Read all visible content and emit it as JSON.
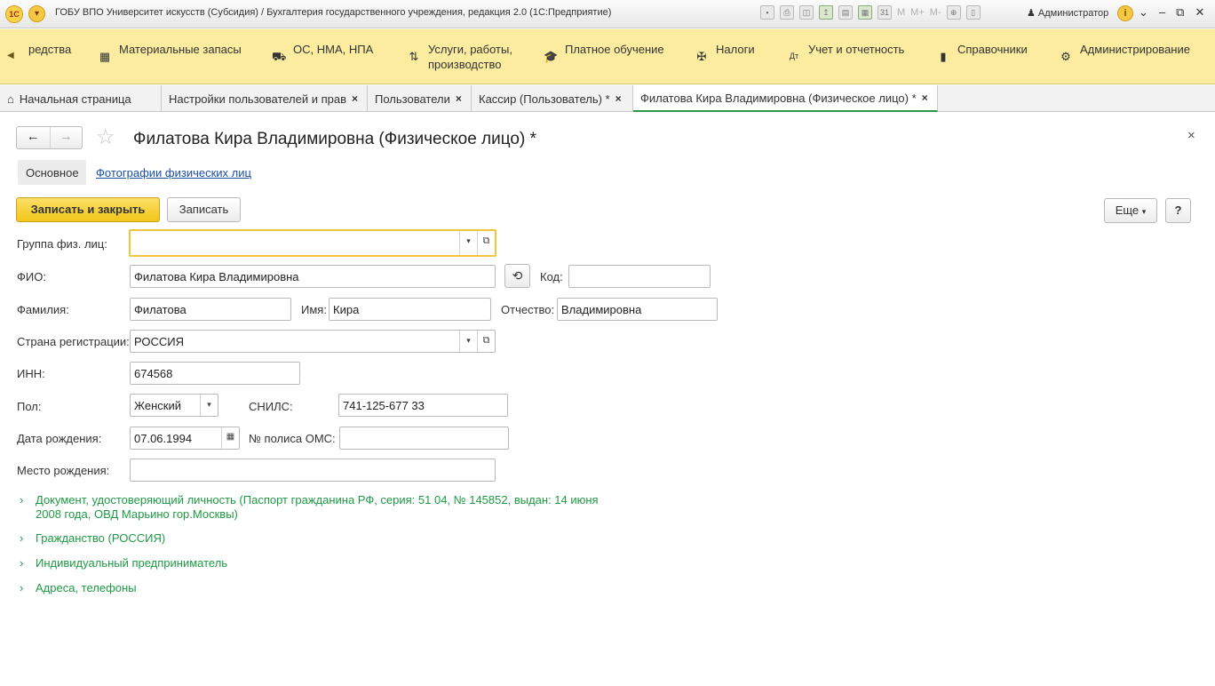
{
  "titlebar": {
    "logo": "1С",
    "title": "ГОБУ ВПО Университет искусств (Субсидия) / Бухгалтерия государственного учреждения, редакция 2.0  (1С:Предприятие)",
    "m_labels": [
      "M",
      "M+",
      "M-"
    ],
    "user": "Администратор",
    "info": "i"
  },
  "sections": [
    {
      "label": "редства",
      "icon": "truncated-section-icon"
    },
    {
      "label": "Материальные запасы",
      "icon": "materials-icon"
    },
    {
      "label": "ОС, НМА, НПА",
      "icon": "truck-icon"
    },
    {
      "label": "Услуги, работы,",
      "label2": "производство",
      "icon": "services-icon"
    },
    {
      "label": "Платное обучение",
      "icon": "graduation-cap-icon"
    },
    {
      "label": "Налоги",
      "icon": "eagle-icon"
    },
    {
      "label": "Учет и отчетность",
      "icon": "accounting-icon"
    },
    {
      "label": "Справочники",
      "icon": "book-icon"
    },
    {
      "label": "Администрирование",
      "icon": "gear-icon"
    }
  ],
  "tabs": [
    {
      "label": "Начальная страница"
    },
    {
      "label": "Настройки пользователей и прав"
    },
    {
      "label": "Пользователи"
    },
    {
      "label": "Кассир (Пользователь) *"
    },
    {
      "label": "Филатова Кира Владимировна (Физическое лицо) *"
    }
  ],
  "form": {
    "title": "Филатова Кира Владимировна (Физическое лицо) *",
    "subtabs": {
      "main": "Основное",
      "photos": "Фотографии физических лиц"
    },
    "buttons": {
      "save_close": "Записать и закрыть",
      "save": "Записать",
      "more": "Еще",
      "help": "?"
    },
    "fields": {
      "group_label": "Группа физ. лиц:",
      "group_value": "",
      "fio_label": "ФИО:",
      "fio_value": "Филатова Кира Владимировна",
      "code_label": "Код:",
      "code_value": "",
      "lastname_label": "Фамилия:",
      "lastname_value": "Филатова",
      "firstname_label": "Имя:",
      "firstname_value": "Кира",
      "patronymic_label": "Отчество:",
      "patronymic_value": "Владимировна",
      "country_label": "Страна регистрации:",
      "country_value": "РОССИЯ",
      "inn_label": "ИНН:",
      "inn_value": "674568",
      "gender_label": "Пол:",
      "gender_value": "Женский",
      "snils_label": "СНИЛС:",
      "snils_value": "741-125-677 33",
      "birthdate_label": "Дата рождения:",
      "birthdate_value": "07.06.1994",
      "oms_label": "№ полиса ОМС:",
      "oms_value": "",
      "birthplace_label": "Место рождения:",
      "birthplace_value": ""
    },
    "groups": [
      {
        "line1": "Документ, удостоверяющий личность (Паспорт гражданина РФ, серия: 51 04, № 145852, выдан: 14 июня",
        "line2": "2008 года, ОВД Марьино гор.Москвы)"
      },
      {
        "line1": "Гражданство (РОССИЯ)"
      },
      {
        "line1": "Индивидуальный предприниматель"
      },
      {
        "line1": "Адреса, телефоны"
      }
    ]
  },
  "colors": {
    "accent_yellow": "#fbeca0",
    "primary_button": "#f2c618",
    "group_green": "#1f9a44",
    "link_blue": "#1a4fa0"
  }
}
